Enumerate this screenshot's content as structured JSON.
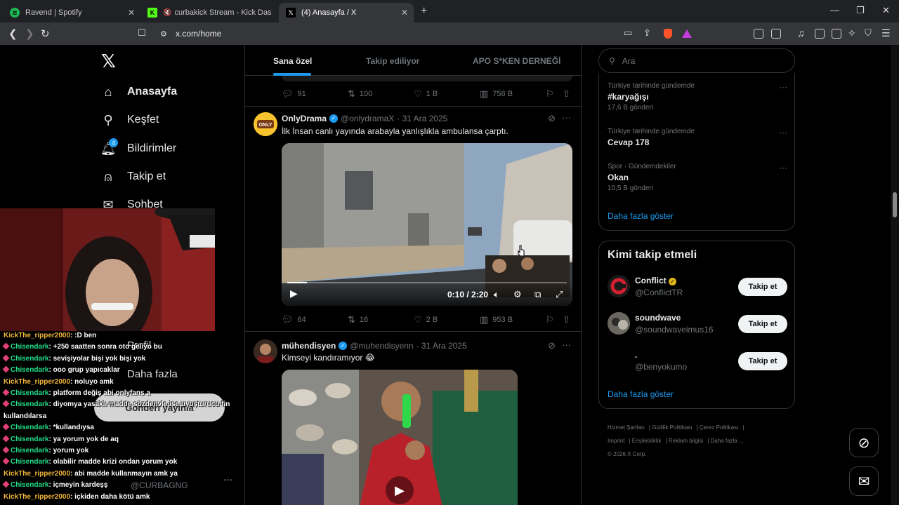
{
  "browser": {
    "tabs": [
      {
        "title": "Ravend | Spotify",
        "icon": "spotify-icon",
        "color": "#1db954"
      },
      {
        "title": "curbakick Stream - Kick Dashboard",
        "icon": "kick-icon",
        "color": "#53fc18"
      },
      {
        "title": "(4) Anasayfa / X",
        "icon": "x-icon",
        "color": "#ffffff"
      }
    ],
    "url": "x.com/home"
  },
  "nav": {
    "home": "Anasayfa",
    "explore": "Keşfet",
    "notifications": "Bildirimler",
    "notif_count": "4",
    "follow": "Takip et",
    "messages": "Sohbet",
    "profile": "Profil",
    "more": "Daha fazla",
    "post_button": "Gönderi yayınla",
    "handle": "@CURBAGNG"
  },
  "timeline": {
    "tabs": [
      "Sana özel",
      "Takip ediliyor",
      "APO S*KEN DERNEĞİ"
    ],
    "prev_post_actions": {
      "replies": "91",
      "reposts": "100",
      "likes": "1 B",
      "views": "756 B"
    },
    "posts": [
      {
        "name": "OnlyDrama",
        "handle": "@onlydramaX",
        "date": "· 31 Ara 2025",
        "text": "İlk İnsan canlı yayında arabayla yanlışlıkla ambulansa çarptı.",
        "video_time": "0:10 / 2:20",
        "video_progress": 0.071,
        "actions": {
          "replies": "64",
          "reposts": "16",
          "likes": "2 B",
          "views": "953 B"
        }
      },
      {
        "name": "mühendisyen",
        "handle": "@muhendisyenn",
        "date": "· 31 Ara 2025",
        "text": "Kimseyi kandıramıyor 😂"
      }
    ]
  },
  "sidebar": {
    "search_placeholder": "Ara",
    "trends": [
      {
        "context": "Türkiye tarihinde gündemde",
        "name": "#karyağışı",
        "count": "17,6 B gönderi"
      },
      {
        "context": "Türkiye tarihinde gündemde",
        "name": "Cevap 178",
        "count": ""
      },
      {
        "context": "Spor · Gündemdekiler",
        "name": "Okan",
        "count": "10,5 B gönderi"
      }
    ],
    "show_more": "Daha fazla göster",
    "who_to_follow_title": "Kimi takip etmeli",
    "suggestions": [
      {
        "name": "Conflict",
        "handle": "@ConflictTR",
        "button": "Takip et"
      },
      {
        "name": "soundwave",
        "handle": "@soundwaveimus16",
        "button": "Takip et"
      },
      {
        "name": ".",
        "handle": "@benyokumo",
        "button": "Takip et"
      }
    ],
    "show_more_2": "Daha fazla göster",
    "footer": [
      "Hizmet Şartları",
      "Gizlilik Politikası",
      "Çerez Politikası",
      "Imprint",
      "Erişilebilirlik",
      "Reklam bilgisi",
      "Daha fazla ...",
      "© 2026 X Corp."
    ]
  },
  "chat": [
    {
      "user": "KickThe_ripper2000",
      "badge": false,
      "msg": ":D ben"
    },
    {
      "user": "Chisendark",
      "badge": true,
      "msg": "+250 saatten sonra oto geliyo bu"
    },
    {
      "user": "Chisendark",
      "badge": true,
      "msg": "sevişiyolar bişi yok bişi yok"
    },
    {
      "user": "Chisendark",
      "badge": true,
      "msg": "ooo grup yapıcaklar"
    },
    {
      "user": "KickThe_ripper2000",
      "badge": false,
      "msg": "noluyo amk"
    },
    {
      "user": "Chisendark",
      "badge": true,
      "msg": "platform değiş abi onlyfans a"
    },
    {
      "user": "Chisendark",
      "badge": true,
      "msg": "diyomya yasaklı madde sözdenvle ise uyuşturucu fin"
    },
    {
      "user": "",
      "badge": false,
      "msg": "kullandılarsa"
    },
    {
      "user": "Chisendark",
      "badge": true,
      "msg": "*kullandıysa"
    },
    {
      "user": "Chisendark",
      "badge": true,
      "msg": "ya yorum yok de aq"
    },
    {
      "user": "Chisendark",
      "badge": true,
      "msg": "yorum yok"
    },
    {
      "user": "Chisendark",
      "badge": true,
      "msg": "olabilir madde krizi ondan yorum yok"
    },
    {
      "user": "KickThe_ripper2000",
      "badge": false,
      "msg": "abi madde kullanmayın amk ya"
    },
    {
      "user": "Chisendark",
      "badge": true,
      "msg": "içmeyin kardeşş"
    },
    {
      "user": "KickThe_ripper2000",
      "badge": false,
      "msg": "içkiden daha kötü amk"
    }
  ]
}
